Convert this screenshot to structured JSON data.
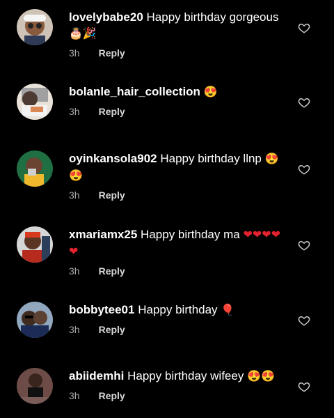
{
  "comments": [
    {
      "username": "lovelybabe20",
      "text": "Happy birthday gorgeous",
      "emoji": "🎂🎉",
      "time": "3h",
      "reply": "Reply",
      "avatar": "#c9a58a"
    },
    {
      "username": "bolanle_hair_collection",
      "text": "",
      "emoji": "😍",
      "time": "3h",
      "reply": "Reply",
      "avatar": "#d8c7b5"
    },
    {
      "username": "oyinkansola902",
      "text": "Happy birthday llnp",
      "emoji": "😍😍",
      "time": "3h",
      "reply": "Reply",
      "avatar": "#3a8e55"
    },
    {
      "username": "xmariamx25",
      "text": "Happy birthday ma",
      "emoji": "❤❤❤❤❤",
      "time": "3h",
      "reply": "Reply",
      "avatar": "#7b5543"
    },
    {
      "username": "bobbytee01",
      "text": "Happy birthday",
      "emoji": "🎈",
      "time": "3h",
      "reply": "Reply",
      "avatar": "#8fa3b6"
    },
    {
      "username": "abiidemhi",
      "text": "Happy birthday wifeey",
      "emoji": "😍😍",
      "time": "3h",
      "reply": "Reply",
      "avatar": "#6b4a45"
    }
  ],
  "colors": {
    "background": "#000000",
    "text": "#ffffff",
    "muted": "#a8a8a8"
  },
  "icons": {
    "like": "heart-outline-icon"
  }
}
